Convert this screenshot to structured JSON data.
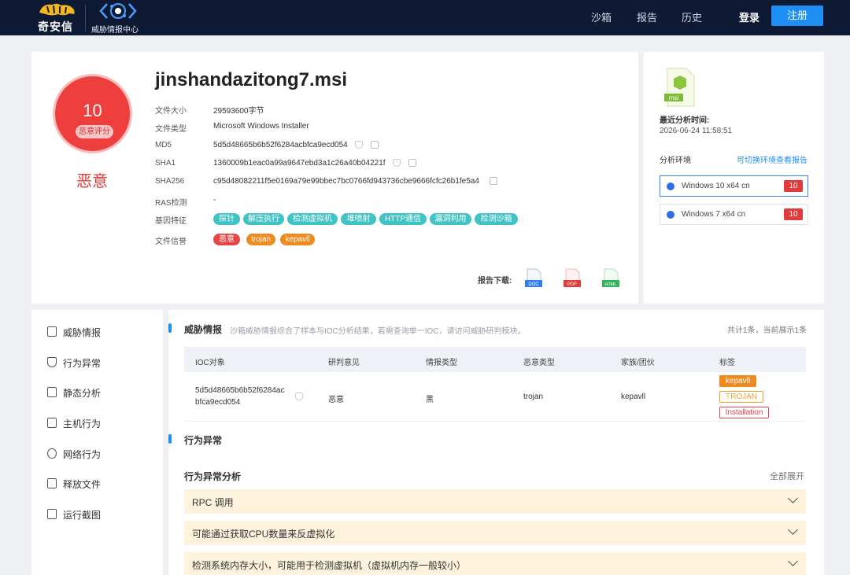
{
  "header": {
    "logo_text": "奇安信",
    "center_label": "威胁情报中心",
    "nav": [
      "沙箱",
      "报告",
      "历史"
    ],
    "login": "登录",
    "register": "注册"
  },
  "summary": {
    "score": "10",
    "score_label": "恶意评分",
    "verdict": "恶意",
    "file_name": "jinshandazitong7.msi",
    "rows": [
      {
        "label": "文件大小",
        "value": "29593600字节"
      },
      {
        "label": "文件类型",
        "value": "Microsoft Windows Installer"
      },
      {
        "label": "MD5",
        "value": "5d5d48665b6b52f6284acbfca9ecd054"
      },
      {
        "label": "SHA1",
        "value": "1360009b1eac0a99a9647ebd3a1c26a40b04221f"
      },
      {
        "label": "SHA256",
        "value": "c95d48082211f5e0169a79e99bbec7bc0766fd943736cbe9666fcfc26b1fe5a4"
      },
      {
        "label": "RAS检测",
        "value": "-"
      },
      {
        "label": "基因特征",
        "value": ""
      },
      {
        "label": "文件信誉",
        "value": ""
      }
    ],
    "gene_tags": [
      "探针",
      "解压执行",
      "检测虚拟机",
      "堆喷射",
      "HTTP通信",
      "漏洞利用",
      "检测沙箱"
    ],
    "reputation_tags": [
      "恶意",
      "trojan",
      "kepavll"
    ],
    "download_label": "报告下载:",
    "download_formats": [
      "DOC",
      "PDF",
      "HTML"
    ]
  },
  "environment": {
    "file_ext": "msi",
    "last_analysis_label": "最近分析时间:",
    "last_analysis_time": "2026-06-24 11:58:51",
    "env_label": "分析环境",
    "switch_link": "可切换环境查看报告",
    "envs": [
      {
        "name": "Windows 10 x64 cn",
        "score": "10"
      },
      {
        "name": "Windows 7 x64 cn",
        "score": "10"
      }
    ]
  },
  "sidebar": {
    "items": [
      "威胁情报",
      "行为异常",
      "静态分析",
      "主机行为",
      "网络行为",
      "释放文件",
      "运行截图"
    ]
  },
  "threat_intel": {
    "title": "威胁情报",
    "desc": "沙箱威胁情报综合了样本与IOC分析结果，若需查询单一IOC，请访问威胁研判模块。",
    "count": "共计1条，当前展示1条",
    "columns": [
      "IOC对象",
      "研判意见",
      "情报类型",
      "恶意类型",
      "家族/团伙",
      "标签"
    ],
    "row": {
      "ioc_line1": "5d5d48665b6b52f6284ac",
      "ioc_line2": "bfca9ecd054",
      "opinion": "恶意",
      "intel_type": "黑",
      "malware_type": "trojan",
      "family": "kepavll",
      "labels": [
        "kepavll",
        "TROJAN",
        "Installation"
      ]
    }
  },
  "behavior": {
    "title": "行为异常",
    "sub_title": "行为异常分析",
    "expand_all": "全部展开",
    "items": [
      "RPC 调用",
      "可能通过获取CPU数量来反虚拟化",
      "检测系统内存大小，可能用于检测虚拟机（虚拟机内存一般较小）"
    ]
  }
}
